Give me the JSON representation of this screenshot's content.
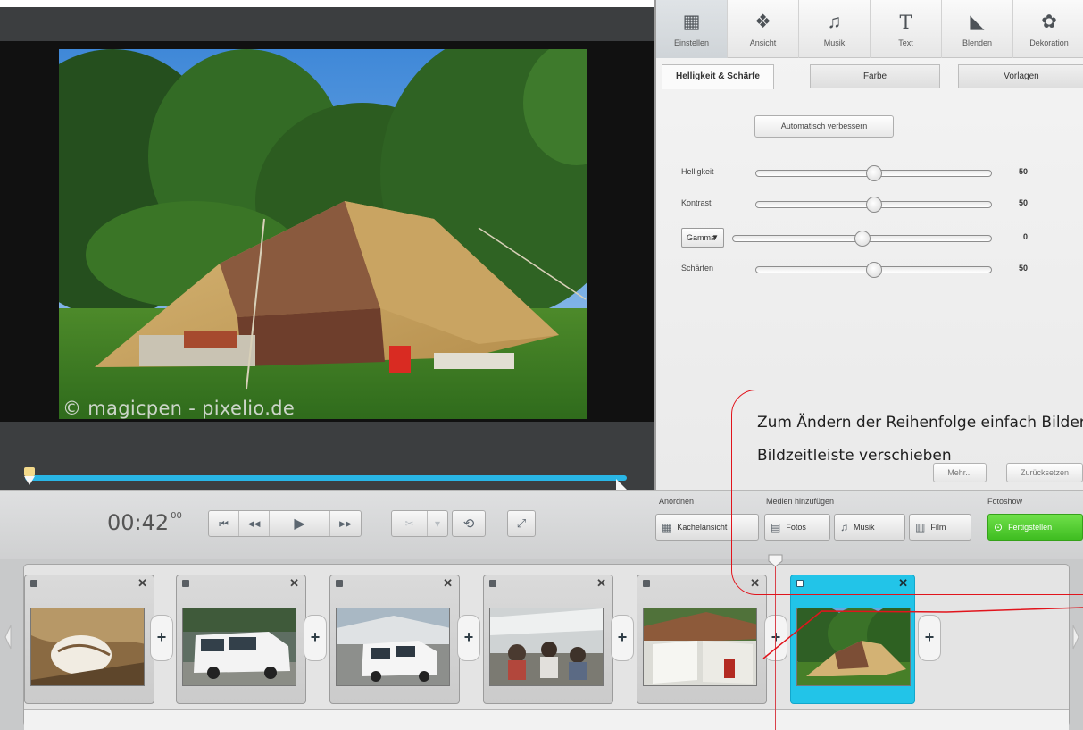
{
  "preview": {
    "watermark": "© magicpen - pixelio.de"
  },
  "tools": [
    {
      "label": "Einstellen",
      "icon": "adjust-icon",
      "glyph": "▦"
    },
    {
      "label": "Ansicht",
      "icon": "view-icon",
      "glyph": "❖"
    },
    {
      "label": "Musik",
      "icon": "music-icon",
      "glyph": "♫"
    },
    {
      "label": "Text",
      "icon": "text-icon",
      "glyph": "T"
    },
    {
      "label": "Blenden",
      "icon": "transition-icon",
      "glyph": "◣"
    },
    {
      "label": "Dekoration",
      "icon": "decoration-icon",
      "glyph": "✿"
    }
  ],
  "subtabs": [
    "Helligkeit & Schärfe",
    "Farbe",
    "Vorlagen"
  ],
  "auto_button": "Automatisch verbessern",
  "sliders": [
    {
      "label": "Helligkeit",
      "value": "50",
      "position": 0.5
    },
    {
      "label": "Kontrast",
      "value": "50",
      "position": 0.5
    },
    {
      "label": "Gamma",
      "value": "0",
      "position": 0.5
    },
    {
      "label": "Schärfen",
      "value": "50",
      "position": 0.5
    }
  ],
  "gamma_select": {
    "selected": "Gamma",
    "caret": "▼"
  },
  "panel_buttons": {
    "menu": "Mehr...",
    "reset": "Zurücksetzen"
  },
  "playback": {
    "time_main": "00:42",
    "time_frames": "00",
    "progress": 0.0,
    "glyph_start": "⏮",
    "glyph_rewind": "◀◀",
    "glyph_play": "▶",
    "glyph_forward": "▶▶",
    "glyph_cut": "✂",
    "glyph_dropdown": "▾",
    "glyph_rotate": "⟲",
    "glyph_fullscreen": "⤢"
  },
  "groups": {
    "arrange": {
      "title": "Anordnen",
      "button": "Kachelansicht",
      "glyph": "▦"
    },
    "media": {
      "title": "Medien hinzufügen",
      "photos": "Fotos",
      "music": "Musik",
      "film": "Film",
      "glyph_photos": "▤",
      "glyph_music": "♫",
      "glyph_film": "▥"
    },
    "slideshow": {
      "title": "Fotoshow",
      "finish": "Fertigstellen",
      "glyph": "⊙"
    }
  },
  "timeline": {
    "close_glyph": "✕",
    "plus_glyph": "+",
    "clips": [
      {
        "name": "clip-1",
        "thumb": "scene-grass"
      },
      {
        "name": "clip-2",
        "thumb": "scene-van"
      },
      {
        "name": "clip-3",
        "thumb": "scene-van-street"
      },
      {
        "name": "clip-4",
        "thumb": "scene-party"
      },
      {
        "name": "clip-5",
        "thumb": "scene-tent-awning"
      },
      {
        "name": "clip-6",
        "thumb": "scene-tent",
        "selected": true
      }
    ]
  },
  "callout": {
    "line1": "Zum Ändern der Reihenfolge einfach Bilder in der",
    "line2": "Bildzeitleiste verschieben"
  },
  "colors": {
    "accent": "#29b6e6",
    "selected_clip": "#22c4e8",
    "finish_green": "#4cc92b",
    "annotation_red": "#e1141c"
  }
}
